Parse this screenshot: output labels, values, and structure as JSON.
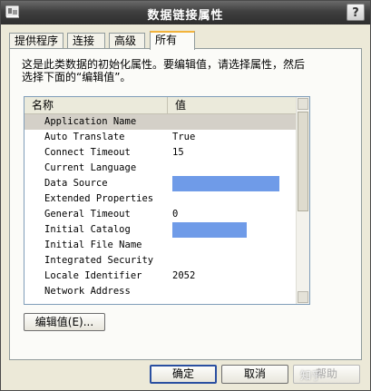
{
  "window": {
    "title": "数据链接属性",
    "help_label": "?"
  },
  "tabs": [
    {
      "label": "提供程序",
      "active": false
    },
    {
      "label": "连接",
      "active": false
    },
    {
      "label": "高级",
      "active": false
    },
    {
      "label": "所有",
      "active": true
    }
  ],
  "description": {
    "line1": "这是此类数据的初始化属性。要编辑值，请选择属性，然后",
    "line2": "选择下面的“编辑值”。"
  },
  "grid": {
    "columns": {
      "name": "名称",
      "value": "值"
    },
    "rows": [
      {
        "name": "Application Name",
        "value": "",
        "selected": true,
        "masked": false
      },
      {
        "name": "Auto Translate",
        "value": "True",
        "selected": false,
        "masked": false
      },
      {
        "name": "Connect Timeout",
        "value": "15",
        "selected": false,
        "masked": false
      },
      {
        "name": "Current Language",
        "value": "",
        "selected": false,
        "masked": false
      },
      {
        "name": "Data Source",
        "value": "",
        "selected": false,
        "masked": true
      },
      {
        "name": "Extended Properties",
        "value": "",
        "selected": false,
        "masked": false
      },
      {
        "name": "General Timeout",
        "value": "0",
        "selected": false,
        "masked": false
      },
      {
        "name": "Initial Catalog",
        "value": "",
        "selected": false,
        "masked": true
      },
      {
        "name": "Initial File Name",
        "value": "",
        "selected": false,
        "masked": false
      },
      {
        "name": "Integrated Security",
        "value": "",
        "selected": false,
        "masked": false
      },
      {
        "name": "Locale Identifier",
        "value": "2052",
        "selected": false,
        "masked": false
      },
      {
        "name": "Network Address",
        "value": "",
        "selected": false,
        "masked": false
      }
    ]
  },
  "buttons": {
    "edit_value": "编辑值(E)...",
    "ok": "确定",
    "cancel": "取消",
    "help": "帮助"
  },
  "watermark": "知乎"
}
